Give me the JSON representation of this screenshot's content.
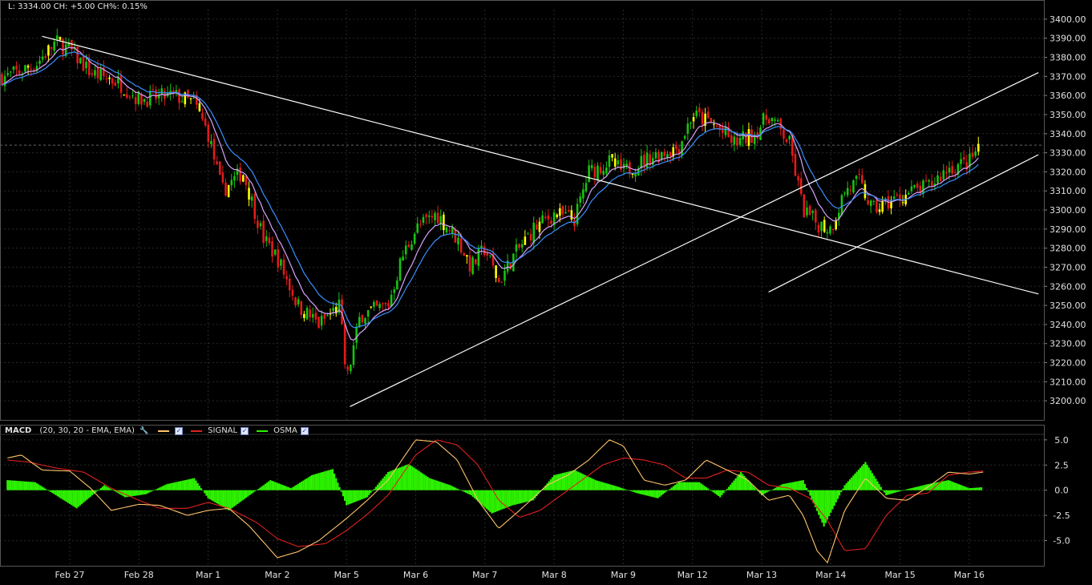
{
  "header": {
    "readout": "L: 3334.00 CH: +5.00 CH%: 0.15%"
  },
  "colors": {
    "up": "#16c40e",
    "down": "#e31a1a",
    "neutral": "#ffff00",
    "ma_fast": "#d9a2ff",
    "ma_slow": "#3a8fff",
    "macd_line": "#ffc46a",
    "signal_line": "#e02020",
    "osma": "#2df200",
    "grid": "#2a2a2a",
    "trendline": "#ffffff"
  },
  "macd_legend": {
    "title": "MACD",
    "params": "(20, 30, 20 - EMA, EMA)",
    "signal_label": "SIGNAL",
    "osma_label": "OSMA"
  },
  "chart_data": [
    {
      "type": "candlestick",
      "title": "",
      "x": [
        "Feb 27",
        "Feb 28",
        "Mar 1",
        "Mar 2",
        "Mar 5",
        "Mar 6",
        "Mar 7",
        "Mar 8",
        "Mar 9",
        "Mar 12",
        "Mar 13",
        "Mar 14",
        "Mar 15",
        "Mar 16"
      ],
      "ylim": [
        3190,
        3405
      ],
      "yticks": [
        3200,
        3210,
        3220,
        3230,
        3240,
        3250,
        3260,
        3270,
        3280,
        3290,
        3300,
        3310,
        3320,
        3330,
        3340,
        3350,
        3360,
        3370,
        3380,
        3390,
        3400
      ],
      "ytick_labels": [
        "3200.00",
        "3210.00",
        "3220.00",
        "3230.00",
        "3240.00",
        "3250.00",
        "3260.00",
        "3270.00",
        "3280.00",
        "3290.00",
        "3300.00",
        "3310.00",
        "3320.00",
        "3330.00",
        "3340.00",
        "3350.00",
        "3360.00",
        "3370.00",
        "3380.00",
        "3390.00",
        "3400.00"
      ],
      "last_price": 3334,
      "price_path": [
        {
          "t": -0.9,
          "p": 3370
        },
        {
          "t": -0.5,
          "p": 3376
        },
        {
          "t": -0.2,
          "p": 3388
        },
        {
          "t": 0.0,
          "p": 3384
        },
        {
          "t": 0.3,
          "p": 3372
        },
        {
          "t": 0.7,
          "p": 3367
        },
        {
          "t": 1.0,
          "p": 3358
        },
        {
          "t": 1.5,
          "p": 3360
        },
        {
          "t": 1.8,
          "p": 3356
        },
        {
          "t": 2.0,
          "p": 3340
        },
        {
          "t": 2.2,
          "p": 3310
        },
        {
          "t": 2.5,
          "p": 3320
        },
        {
          "t": 2.8,
          "p": 3285
        },
        {
          "t": 3.0,
          "p": 3275
        },
        {
          "t": 3.3,
          "p": 3250
        },
        {
          "t": 3.6,
          "p": 3240
        },
        {
          "t": 3.9,
          "p": 3250
        },
        {
          "t": 4.0,
          "p": 3210
        },
        {
          "t": 4.2,
          "p": 3245
        },
        {
          "t": 4.6,
          "p": 3250
        },
        {
          "t": 4.8,
          "p": 3275
        },
        {
          "t": 5.0,
          "p": 3290
        },
        {
          "t": 5.3,
          "p": 3298
        },
        {
          "t": 5.6,
          "p": 3285
        },
        {
          "t": 5.8,
          "p": 3270
        },
        {
          "t": 6.0,
          "p": 3280
        },
        {
          "t": 6.2,
          "p": 3262
        },
        {
          "t": 6.4,
          "p": 3275
        },
        {
          "t": 6.7,
          "p": 3290
        },
        {
          "t": 7.0,
          "p": 3298
        },
        {
          "t": 7.3,
          "p": 3295
        },
        {
          "t": 7.5,
          "p": 3320
        },
        {
          "t": 7.8,
          "p": 3325
        },
        {
          "t": 8.0,
          "p": 3320
        },
        {
          "t": 8.4,
          "p": 3328
        },
        {
          "t": 8.8,
          "p": 3333
        },
        {
          "t": 9.0,
          "p": 3350
        },
        {
          "t": 9.3,
          "p": 3345
        },
        {
          "t": 9.6,
          "p": 3335
        },
        {
          "t": 9.9,
          "p": 3340
        },
        {
          "t": 10.1,
          "p": 3350
        },
        {
          "t": 10.4,
          "p": 3335
        },
        {
          "t": 10.6,
          "p": 3300
        },
        {
          "t": 10.8,
          "p": 3293
        },
        {
          "t": 11.0,
          "p": 3290
        },
        {
          "t": 11.2,
          "p": 3310
        },
        {
          "t": 11.4,
          "p": 3315
        },
        {
          "t": 11.6,
          "p": 3300
        },
        {
          "t": 11.9,
          "p": 3305
        },
        {
          "t": 12.2,
          "p": 3310
        },
        {
          "t": 12.4,
          "p": 3312
        },
        {
          "t": 12.7,
          "p": 3322
        },
        {
          "t": 13.0,
          "p": 3325
        },
        {
          "t": 13.15,
          "p": 3334
        }
      ],
      "trendlines": [
        {
          "t1": -0.4,
          "p1": 3391,
          "t2": 14.0,
          "p2": 3256
        },
        {
          "t1": 4.05,
          "p1": 3197,
          "t2": 14.0,
          "p2": 3372
        },
        {
          "t1": 10.1,
          "p1": 3257,
          "t2": 14.0,
          "p2": 3329
        }
      ]
    },
    {
      "type": "line",
      "title": "MACD",
      "x": [
        "Feb 27",
        "Feb 28",
        "Mar 1",
        "Mar 2",
        "Mar 5",
        "Mar 6",
        "Mar 7",
        "Mar 8",
        "Mar 9",
        "Mar 12",
        "Mar 13",
        "Mar 14",
        "Mar 15",
        "Mar 16"
      ],
      "ylim": [
        -7.5,
        6.5
      ],
      "yticks": [
        -5.0,
        -2.5,
        0.0,
        2.5,
        5.0
      ],
      "ytick_labels": [
        "-5.0",
        "-2.5",
        "0.0",
        "2.5",
        "5.0"
      ],
      "series": [
        {
          "name": "MACD",
          "t": [
            -0.9,
            -0.7,
            -0.4,
            0.0,
            0.3,
            0.6,
            1.0,
            1.3,
            1.7,
            2.0,
            2.3,
            2.6,
            3.0,
            3.3,
            3.6,
            4.0,
            4.3,
            4.6,
            5.0,
            5.3,
            5.6,
            5.9,
            6.2,
            6.5,
            6.9,
            7.2,
            7.5,
            7.8,
            8.0,
            8.3,
            8.6,
            8.9,
            9.2,
            9.5,
            9.8,
            10.1,
            10.4,
            10.6,
            10.8,
            10.95,
            11.2,
            11.5,
            11.8,
            12.1,
            12.4,
            12.7,
            13.0,
            13.2
          ],
          "values": [
            3.2,
            3.5,
            2.0,
            1.9,
            0.2,
            -2.0,
            -1.4,
            -1.5,
            -2.5,
            -2.0,
            -1.8,
            -3.6,
            -6.7,
            -6.1,
            -5.0,
            -2.8,
            -1.0,
            1.0,
            5.0,
            4.8,
            3.0,
            -1.0,
            -3.8,
            -2.0,
            0.5,
            1.5,
            3.0,
            5.0,
            4.4,
            1.0,
            0.5,
            1.0,
            3.0,
            2.0,
            1.0,
            -1.0,
            -0.5,
            -2.5,
            -6.0,
            -7.2,
            -2.0,
            1.2,
            -0.8,
            -1.0,
            0.3,
            1.8,
            1.6,
            1.8
          ]
        },
        {
          "name": "SIGNAL",
          "t": [
            -0.9,
            -0.6,
            -0.2,
            0.2,
            0.6,
            1.0,
            1.3,
            1.7,
            2.0,
            2.3,
            2.7,
            3.0,
            3.3,
            3.7,
            4.0,
            4.3,
            4.6,
            5.0,
            5.3,
            5.6,
            5.9,
            6.2,
            6.5,
            6.8,
            7.1,
            7.4,
            7.7,
            8.0,
            8.3,
            8.6,
            8.9,
            9.2,
            9.5,
            9.8,
            10.1,
            10.4,
            10.7,
            10.95,
            11.2,
            11.5,
            11.8,
            12.1,
            12.4,
            12.7,
            13.0,
            13.2
          ],
          "values": [
            3.0,
            2.8,
            2.2,
            1.8,
            0.2,
            -1.0,
            -1.8,
            -1.8,
            -1.2,
            -1.8,
            -3.2,
            -4.8,
            -5.6,
            -5.3,
            -4.0,
            -2.4,
            -0.5,
            3.5,
            5.0,
            4.5,
            2.5,
            -1.0,
            -2.7,
            -2.0,
            -0.5,
            1.0,
            2.5,
            3.2,
            3.0,
            2.5,
            1.2,
            1.2,
            2.0,
            1.8,
            0.5,
            0.2,
            -0.8,
            -3.0,
            -6.0,
            -5.8,
            -2.5,
            -0.5,
            -0.3,
            1.5,
            1.8,
            1.9
          ]
        },
        {
          "name": "OSMA",
          "t": [
            -0.9,
            -0.5,
            -0.2,
            0.1,
            0.5,
            0.8,
            1.1,
            1.4,
            1.8,
            2.0,
            2.3,
            2.6,
            2.9,
            3.2,
            3.5,
            3.8,
            4.0,
            4.3,
            4.6,
            4.9,
            5.2,
            5.5,
            5.8,
            6.1,
            6.4,
            6.7,
            7.0,
            7.3,
            7.6,
            7.9,
            8.2,
            8.5,
            8.8,
            9.1,
            9.4,
            9.7,
            10.0,
            10.3,
            10.6,
            10.9,
            11.2,
            11.5,
            11.8,
            12.1,
            12.4,
            12.7,
            13.0,
            13.2
          ],
          "values": [
            1.0,
            0.8,
            -0.5,
            -1.8,
            0.5,
            -0.7,
            -0.4,
            0.6,
            1.2,
            -0.8,
            -2.0,
            -0.5,
            1.0,
            0.2,
            1.5,
            2.1,
            -1.5,
            -0.7,
            1.8,
            2.6,
            1.2,
            0.5,
            -0.5,
            -2.3,
            -1.5,
            -1.0,
            1.5,
            2.0,
            1.0,
            0.4,
            -0.3,
            -0.8,
            0.8,
            0.8,
            -0.7,
            1.8,
            -0.5,
            0.6,
            1.0,
            -3.6,
            0.5,
            2.8,
            -0.5,
            0.1,
            0.6,
            1.0,
            0.2,
            0.3
          ]
        }
      ]
    }
  ]
}
